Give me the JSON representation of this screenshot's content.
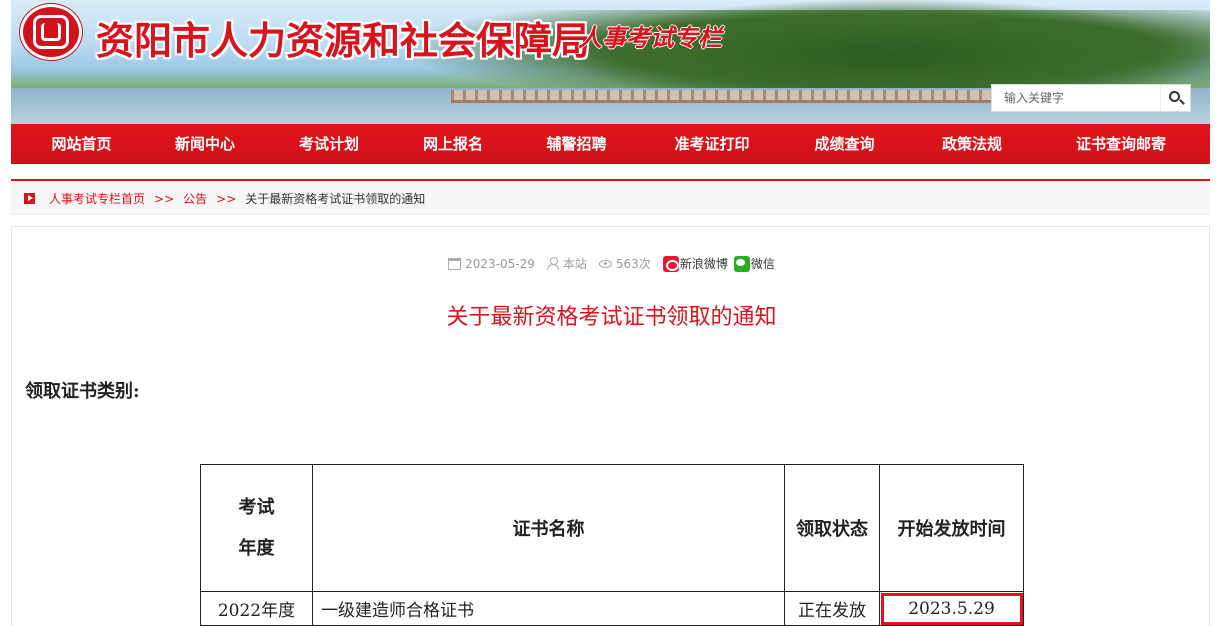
{
  "header": {
    "site_title": "资阳市人力资源和社会保障局",
    "site_subtitle": "人事考试专栏",
    "search_placeholder": "输入关键字",
    "search_icon": "search-icon"
  },
  "nav": {
    "items": [
      "网站首页",
      "新闻中心",
      "考试计划",
      "网上报名",
      "辅警招聘",
      "准考证打印",
      "成绩查询",
      "政策法规",
      "证书查询邮寄"
    ]
  },
  "breadcrumb": {
    "home": "人事考试专栏首页",
    "section": "公告",
    "current": "关于最新资格考试证书领取的通知",
    "separator": ">>"
  },
  "article": {
    "date": "2023-05-29",
    "author": "本站",
    "views": "563次",
    "share_weibo": "新浪微博",
    "share_wechat": "微信",
    "title": "关于最新资格考试证书领取的通知",
    "lead": "领取证书类别:"
  },
  "table": {
    "headers": {
      "year_line1": "考试",
      "year_line2": "年度",
      "name": "证书名称",
      "status": "领取状态",
      "start": "开始发放时间"
    },
    "rows": [
      {
        "year": "2022年度",
        "name": "一级建造师合格证书",
        "status": "正在发放",
        "start": "2023.5.29"
      }
    ]
  },
  "colors": {
    "accent": "#d7141d",
    "highlight": "#e0141c"
  }
}
